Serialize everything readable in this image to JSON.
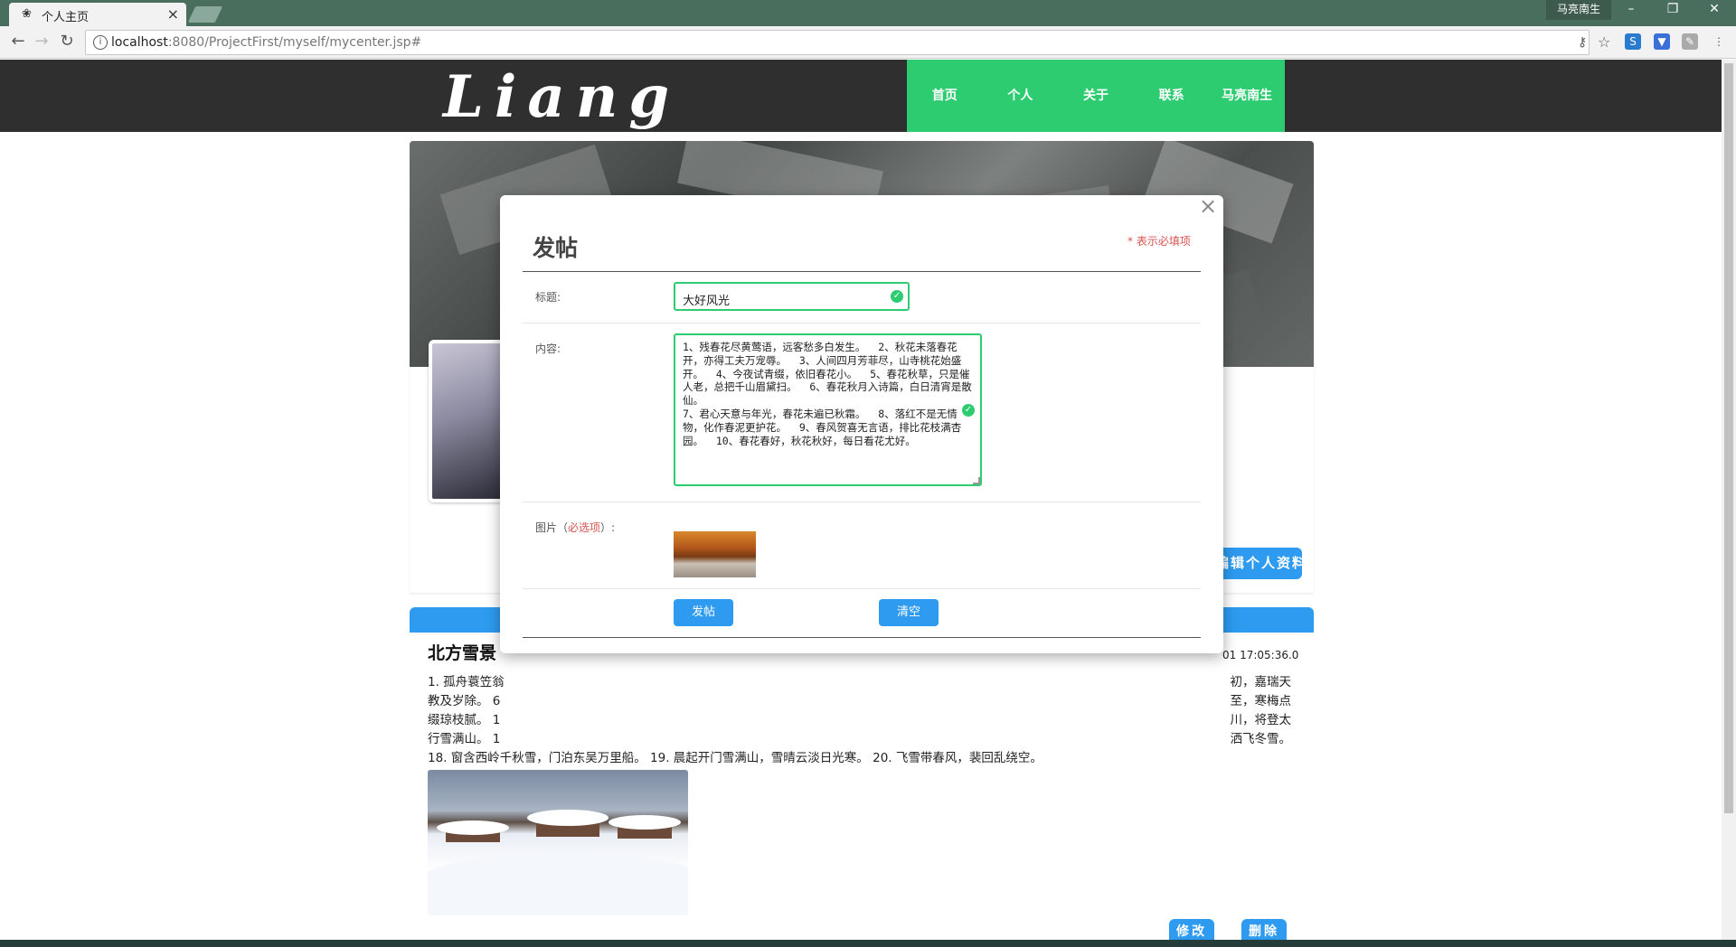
{
  "browser": {
    "tab_title": "个人主页",
    "tab_close": "×",
    "user_label": "马亮南生",
    "minimize": "–",
    "restore": "❐",
    "close": "✕",
    "url_host": "localhost",
    "url_path": ":8080/ProjectFirst/myself/mycenter.jsp#"
  },
  "site": {
    "logo": "Liang",
    "nav": [
      "首页",
      "个人",
      "关于",
      "联系",
      "马亮南生"
    ]
  },
  "profile": {
    "edit_button": "编辑个人资料"
  },
  "post": {
    "title": "北方雪景",
    "date": "01 17:05:36.0",
    "body_lines": [
      "1. 孤舟蓑笠翁",
      "教及岁除。 6",
      "缀琼枝腻。 1",
      "行雪满山。 1",
      "18. 窗含西岭千秋雪，门泊东吴万里船。 19. 晨起开门雪满山，雪晴云淡日光寒。 20. 飞雪带春风，裴回乱绕空。"
    ],
    "body_right_lines": [
      "初，嘉瑞天",
      "至，寒梅点",
      "川，将登太",
      "洒飞冬雪。"
    ],
    "modify_button": "修改",
    "delete_button": "删除"
  },
  "modal": {
    "close": "×",
    "title": "发帖",
    "required_note": "* 表示必填项",
    "title_label": "标题:",
    "title_value": "大好风光",
    "content_label": "内容:",
    "content_value": "1、残春花尽黄莺语，远客愁多白发生。  2、秋花未落春花开，亦得工夫万宠辱。  3、人间四月芳菲尽，山寺桃花始盛开。  4、今夜试青缀，依旧春花小。  5、春花秋草，只是催人老，总把千山眉黛扫。  6、春花秋月入诗篇，白日清宵是散仙。\n7、君心天意与年光，春花未遍已秋霜。  8、落红不是无情物，化作春泥更护花。  9、春风贺喜无言语，排比花枝满杏园。  10、春花春好，秋花秋好，每日看花尤好。",
    "image_label_prefix": "图片（",
    "image_label_required": "必选项",
    "image_label_suffix": "）:",
    "submit_button": "发帖",
    "clear_button": "清空"
  },
  "colors": {
    "green": "#2ecc71",
    "blue": "#2e9bf0",
    "header": "#2f2f2f",
    "required": "#d9534f"
  }
}
